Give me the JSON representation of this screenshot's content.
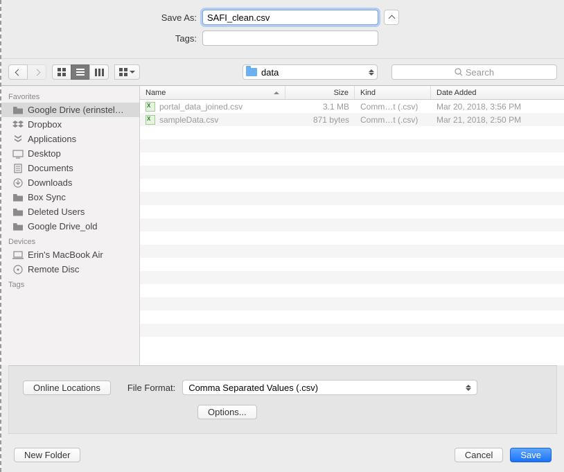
{
  "header": {
    "save_as_label": "Save As:",
    "save_as_value": "SAFI_clean.csv",
    "tags_label": "Tags:",
    "tags_value": ""
  },
  "toolbar": {
    "folder_name": "data",
    "search_placeholder": "Search"
  },
  "sidebar": {
    "favorites_heading": "Favorites",
    "devices_heading": "Devices",
    "tags_heading": "Tags",
    "favorites": [
      {
        "label": "Google Drive (erinstel…",
        "icon": "folder"
      },
      {
        "label": "Dropbox",
        "icon": "dropbox"
      },
      {
        "label": "Applications",
        "icon": "apps"
      },
      {
        "label": "Desktop",
        "icon": "desktop"
      },
      {
        "label": "Documents",
        "icon": "docs"
      },
      {
        "label": "Downloads",
        "icon": "downloads"
      },
      {
        "label": "Box Sync",
        "icon": "folder"
      },
      {
        "label": "Deleted Users",
        "icon": "folder"
      },
      {
        "label": "Google Drive_old",
        "icon": "folder"
      }
    ],
    "devices": [
      {
        "label": "Erin's MacBook Air",
        "icon": "laptop"
      },
      {
        "label": "Remote Disc",
        "icon": "disc"
      }
    ]
  },
  "columns": {
    "name": "Name",
    "size": "Size",
    "kind": "Kind",
    "date": "Date Added"
  },
  "files": [
    {
      "name": "portal_data_joined.csv",
      "size": "3.1 MB",
      "kind": "Comm…t (.csv)",
      "date": "Mar 20, 2018, 3:56 PM"
    },
    {
      "name": "sampleData.csv",
      "size": "871 bytes",
      "kind": "Comm…t (.csv)",
      "date": "Mar 21, 2018, 2:50 PM"
    }
  ],
  "bottom": {
    "online_locations": "Online Locations",
    "file_format_label": "File Format:",
    "file_format_value": "Comma Separated Values (.csv)",
    "options": "Options..."
  },
  "footer": {
    "new_folder": "New Folder",
    "cancel": "Cancel",
    "save": "Save"
  }
}
